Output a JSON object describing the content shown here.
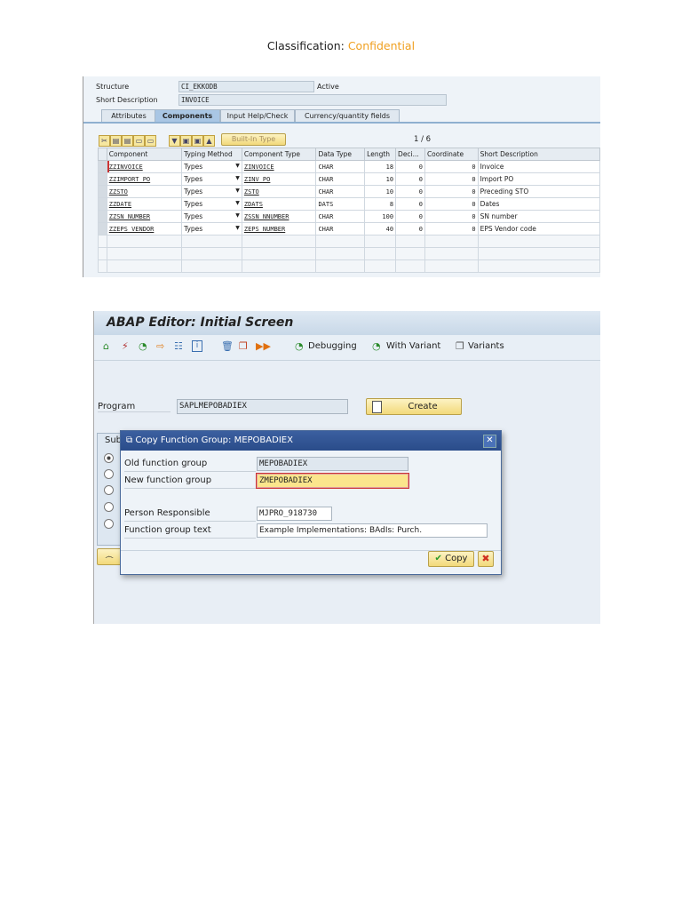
{
  "header": {
    "classification_label": "Classification:",
    "classification_value": "Confidential",
    "classification_color": "#f0a020"
  },
  "structure_screen": {
    "structure_label": "Structure",
    "structure_value": "CI_EKKODB",
    "status": "Active",
    "short_desc_label": "Short Description",
    "short_desc_value": "INVOICE",
    "tabs": [
      {
        "label": "Attributes"
      },
      {
        "label": "Components",
        "active": true
      },
      {
        "label": "Input Help/Check"
      },
      {
        "label": "Currency/quantity fields"
      }
    ],
    "builtin_type_label": "Built-In Type",
    "pager": "1 / 6",
    "columns": [
      "Component",
      "Typing Method",
      "Component Type",
      "Data Type",
      "Length",
      "Deci...",
      "Coordinate",
      "Short Description"
    ],
    "rows": [
      [
        "ZZINVOICE",
        "Types",
        "ZINVOICE",
        "CHAR",
        "18",
        "0",
        "0",
        "Invoice"
      ],
      [
        "ZZIMPORT_PO",
        "Types",
        "ZINV_PO",
        "CHAR",
        "10",
        "0",
        "0",
        "Import PO"
      ],
      [
        "ZZSTO",
        "Types",
        "ZSTO",
        "CHAR",
        "10",
        "0",
        "0",
        "Preceding STO"
      ],
      [
        "ZZDATE",
        "Types",
        "ZDATS",
        "DATS",
        "8",
        "0",
        "0",
        "Dates"
      ],
      [
        "ZZSN_NUMBER",
        "Types",
        "ZSSN_NNUMBER",
        "CHAR",
        "100",
        "0",
        "0",
        "SN number"
      ],
      [
        "ZZEPS_VENDOR",
        "Types",
        "ZEPS_NUMBER",
        "CHAR",
        "40",
        "0",
        "0",
        "EPS Vendor code"
      ]
    ]
  },
  "abap_editor": {
    "title": "ABAP Editor: Initial Screen",
    "toolbar": {
      "debugging": "Debugging",
      "with_variant": "With Variant",
      "variants": "Variants"
    },
    "program_label": "Program",
    "program_value": "SAPLMEPOBADIEX",
    "create_label": "Create",
    "subobjects_label": "Sub",
    "dialog": {
      "title": "Copy Function Group: MEPOBADIEX",
      "old_fg_label": "Old function group",
      "old_fg_value": "MEPOBADIEX",
      "new_fg_label": "New function group",
      "new_fg_value": "ZMEPOBADIEX",
      "person_label": "Person Responsible",
      "person_value": "MJPRO_918730",
      "fg_text_label": "Function group text",
      "fg_text_value": "Example Implementations: BAdIs: Purch.",
      "copy_label": "Copy"
    }
  }
}
